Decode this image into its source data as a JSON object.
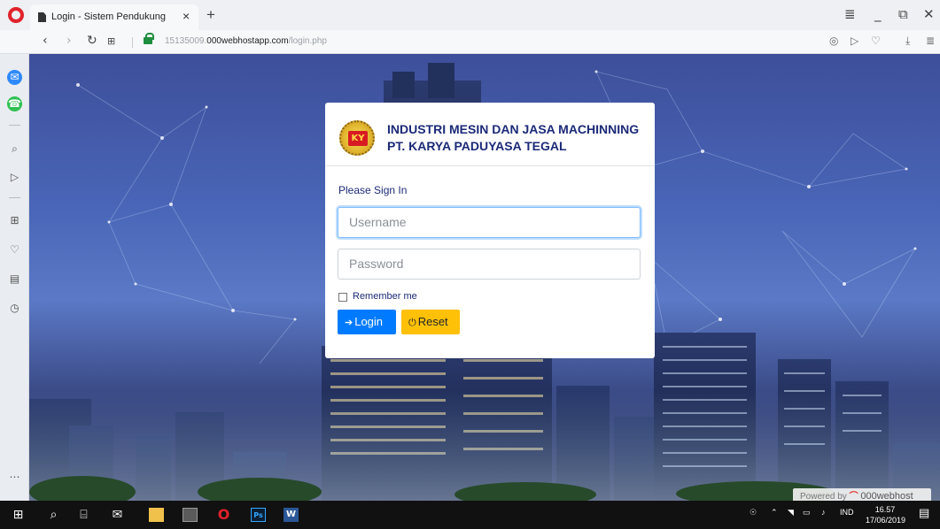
{
  "browser": {
    "tab_title": "Login - Sistem Pendukung",
    "tab_close": "×",
    "new_tab": "+",
    "url_host_prefix": "15135009.",
    "url_host": "000webhostapp.com",
    "url_path": "/login.php",
    "window_controls": [
      "≣",
      "_",
      "⧉",
      "✕"
    ]
  },
  "page": {
    "company_line1": "INDUSTRI MESIN DAN JASA MACHINNING",
    "company_line2": "PT. KARYA PADUYASA TEGAL",
    "logo_text": "KY",
    "signin_title": "Please Sign In",
    "username_placeholder": "Username",
    "password_placeholder": "Password",
    "remember_label": "Remember me",
    "login_label": "Login",
    "reset_label": "Reset",
    "powered_by": "Powered by",
    "powered_brand": "000webhost"
  },
  "colors": {
    "login_button": "#007bff",
    "reset_button": "#ffc107",
    "heading_text": "#1b2a78"
  },
  "taskbar": {
    "language": "IND",
    "time": "16.57",
    "date": "17/06/2019"
  }
}
